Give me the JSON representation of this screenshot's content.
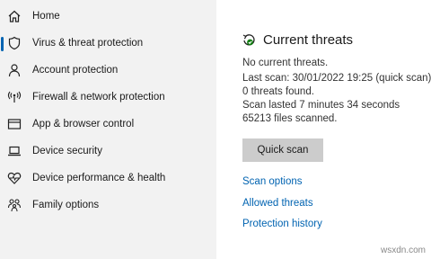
{
  "sidebar": {
    "items": [
      {
        "label": "Home",
        "icon": "home-icon",
        "selected": false
      },
      {
        "label": "Virus & threat protection",
        "icon": "shield-icon",
        "selected": true
      },
      {
        "label": "Account protection",
        "icon": "person-icon",
        "selected": false
      },
      {
        "label": "Firewall & network protection",
        "icon": "wifi-antenna-icon",
        "selected": false
      },
      {
        "label": "App & browser control",
        "icon": "browser-window-icon",
        "selected": false
      },
      {
        "label": "Device security",
        "icon": "laptop-icon",
        "selected": false
      },
      {
        "label": "Device performance & health",
        "icon": "heart-icon",
        "selected": false
      },
      {
        "label": "Family options",
        "icon": "family-icon",
        "selected": false
      }
    ],
    "accent": "#0063b1"
  },
  "main": {
    "title": "Current threats",
    "status_icon": "refresh-shield-check-icon",
    "lines": [
      "No current threats.",
      "Last scan: 30/01/2022 19:25 (quick scan)",
      "0 threats found.",
      "Scan lasted 7 minutes 34 seconds",
      "65213 files scanned."
    ],
    "quick_scan_label": "Quick scan",
    "links": [
      "Scan options",
      "Allowed threats",
      "Protection history"
    ],
    "link_color": "#0063b1",
    "status_color": "#107c10"
  },
  "watermark": "wsxdn.com"
}
